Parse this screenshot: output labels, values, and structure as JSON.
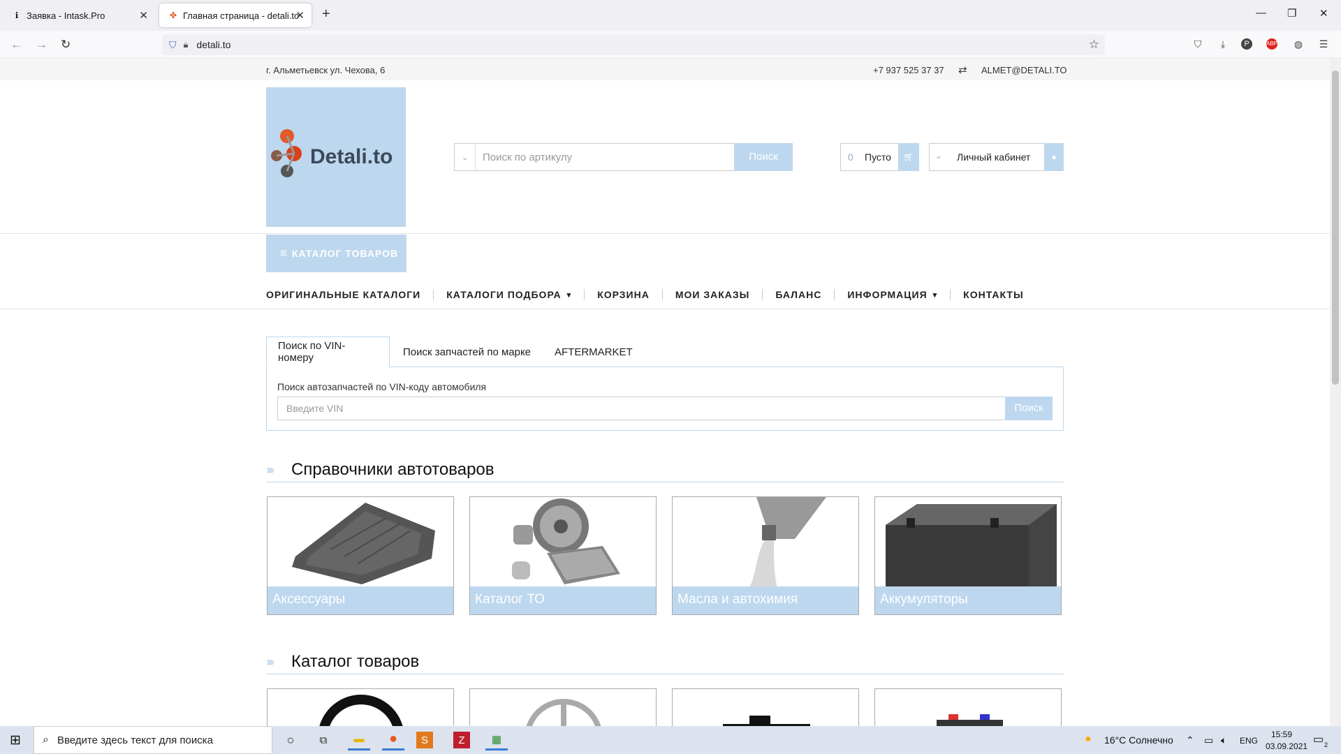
{
  "browser": {
    "tabs": [
      {
        "label": "Заявка - Intask.Pro",
        "icon": "info-icon"
      },
      {
        "label": "Главная страница - detali.to",
        "icon": "site-favicon"
      }
    ],
    "url": "detali.to"
  },
  "site": {
    "address": "г. Альметьевск ул. Чехова, 6",
    "phone": "+7 937 525 37 37",
    "email": "ALMET@DETALI.TO",
    "logo_text": "Detali.to",
    "search_placeholder": "Поиск по артикулу",
    "search_button": "Поиск",
    "cart_count": "0",
    "cart_label": "Пусто",
    "cabinet_label": "Личный кабинет",
    "catalog_button": "КАТАЛОГ ТОВАРОВ",
    "nav": [
      "ОРИГИНАЛЬНЫЕ КАТАЛОГИ",
      "КАТАЛОГИ ПОДБОРА",
      "КОРЗИНА",
      "МОИ ЗАКАЗЫ",
      "БАЛАНС",
      "ИНФОРМАЦИЯ",
      "КОНТАКТЫ"
    ],
    "search_tabs": [
      "Поиск по VIN-номеру",
      "Поиск запчастей по марке",
      "AFTERMARKET"
    ],
    "vin_label": "Поиск автозапчастей по VIN-коду автомобиля",
    "vin_placeholder": "Введите VIN",
    "vin_button": "Поиск",
    "section1_title": "Справочники автотоваров",
    "cards": [
      "Аксессуары",
      "Каталог ТО",
      "Масла и автохимия",
      "Аккумуляторы"
    ],
    "section2_title": "Каталог товаров"
  },
  "taskbar": {
    "search_placeholder": "Введите здесь текст для поиска",
    "weather": "16°C  Солнечно",
    "lang": "ENG",
    "time": "15:59",
    "date": "03.09.2021",
    "notifications": "2"
  },
  "colors": {
    "accent": "#bdd7ee"
  }
}
